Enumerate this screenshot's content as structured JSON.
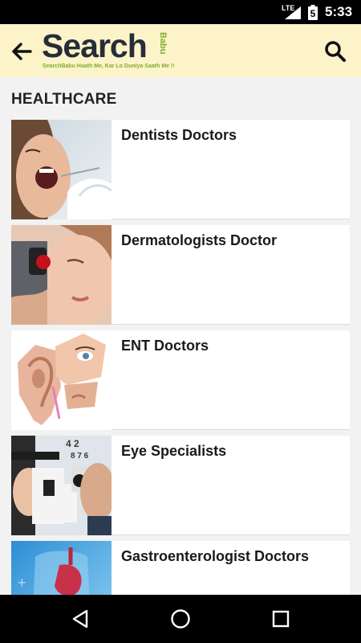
{
  "status_bar": {
    "network": "LTE",
    "battery_level": "5",
    "time": "5:33"
  },
  "app_bar": {
    "logo_text": "Search",
    "logo_side_text": "Babu",
    "logo_tagline": "SearchBabu Haath Me, Kar Lo Duniya Saath Me !!",
    "back_icon": "arrow-left-icon",
    "search_icon": "search-icon"
  },
  "section": {
    "title": "HEALTHCARE"
  },
  "categories": [
    {
      "title": "Dentists Doctors",
      "image": "dentist-photo"
    },
    {
      "title": "Dermatologists Doctor",
      "image": "dermatologist-photo"
    },
    {
      "title": "ENT Doctors",
      "image": "ent-photo"
    },
    {
      "title": "Eye Specialists",
      "image": "eye-specialist-photo"
    },
    {
      "title": "Gastroenterologist Doctors",
      "image": "gastroenterologist-photo"
    }
  ],
  "nav_bar": {
    "back": "triangle-back-icon",
    "home": "circle-home-icon",
    "recents": "square-recents-icon"
  },
  "colors": {
    "app_bar_bg": "#fcf3c9",
    "logo_dark": "#262d38",
    "logo_green": "#7fae2a",
    "page_bg": "#f2f2f2"
  }
}
